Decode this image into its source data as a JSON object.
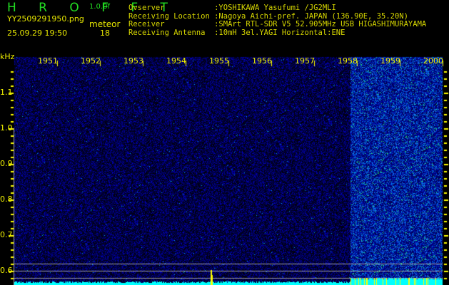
{
  "header": {
    "app_title": "H R O F F T",
    "version": "1.0.0f",
    "filename": "YY2509291950.png",
    "datetime": "25.09.29 19:50",
    "meteor_label": "meteor",
    "meteor_count": "18",
    "info_lines": [
      "Ovserver           :YOSHIKAWA Yasufumi /JG2MLI",
      "Receiving Location :Nagoya Aichi-pref. JAPAN (136.90E, 35.20N)",
      "Receiver           :SMArt RTL-SDR V5 52.905MHz USB HIGASHIMURAYAMA",
      "Receiving Antenna  :10mH 3el.YAGI Horizontal:ENE"
    ]
  },
  "chart_data": {
    "type": "heatmap",
    "ylabel": "kHz",
    "y_ticks": [
      "1.1",
      "1.0",
      "0.9",
      "0.8",
      "0.7",
      "0.6"
    ],
    "ylim": [
      0.56,
      1.2
    ],
    "x_ticks": [
      "1951",
      "1952",
      "1953",
      "1954",
      "1955",
      "1956",
      "1957",
      "1958",
      "1959",
      "2000"
    ],
    "reference_lines_khz": [
      0.62,
      0.6,
      0.58
    ],
    "colors": {
      "background": "#000000",
      "noise_low": "#1010a0",
      "noise_high": "#30c0ff",
      "text": "#e8e800",
      "title": "#22dd22",
      "baseline": "#00ffff",
      "marker": "#ffff00",
      "ref_line": "#a0a0a0"
    }
  }
}
